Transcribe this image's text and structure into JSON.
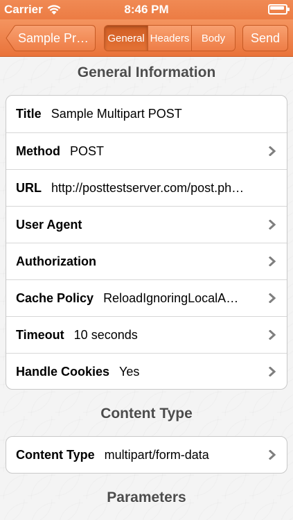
{
  "status_bar": {
    "carrier": "Carrier",
    "time": "8:46 PM"
  },
  "nav": {
    "back_label": "Sample Pr…",
    "segments": [
      {
        "label": "General",
        "active": true
      },
      {
        "label": "Headers",
        "active": false
      },
      {
        "label": "Body",
        "active": false
      }
    ],
    "send_label": "Send"
  },
  "general": {
    "header": "General Information",
    "rows": [
      {
        "label": "Title",
        "value": "Sample Multipart POST",
        "chevron": false
      },
      {
        "label": "Method",
        "value": "POST",
        "chevron": true
      },
      {
        "label": "URL",
        "value": "http://posttestserver.com/post.ph…",
        "chevron": false
      },
      {
        "label": "User Agent",
        "value": "",
        "chevron": true
      },
      {
        "label": "Authorization",
        "value": "",
        "chevron": true
      },
      {
        "label": "Cache Policy",
        "value": "ReloadIgnoringLocalA…",
        "chevron": true
      },
      {
        "label": "Timeout",
        "value": "10 seconds",
        "chevron": true
      },
      {
        "label": "Handle Cookies",
        "value": "Yes",
        "chevron": true
      }
    ]
  },
  "content_type": {
    "header": "Content Type",
    "rows": [
      {
        "label": "Content Type",
        "value": "multipart/form-data",
        "chevron": true
      }
    ]
  },
  "parameters": {
    "header": "Parameters"
  },
  "colors": {
    "nav_orange": "#ec7c44",
    "chevron_gray": "#7f7f7f"
  }
}
